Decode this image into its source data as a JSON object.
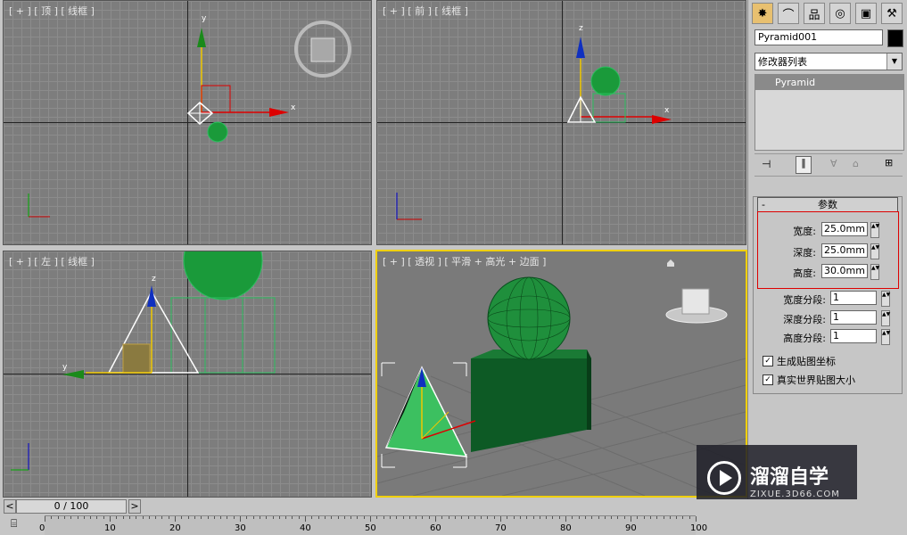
{
  "viewports": {
    "top": {
      "label": "[ + ] [ 顶 ] [ 线框 ]"
    },
    "front": {
      "label": "[ + ] [ 前 ] [ 线框 ]"
    },
    "left": {
      "label": "[ + ] [ 左 ] [ 线框 ]"
    },
    "persp": {
      "label": "[ + ] [ 透视 ] [ 平滑 + 高光 + 边面 ]"
    }
  },
  "axis_letters": {
    "x": "x",
    "y": "y",
    "z": "z"
  },
  "panel": {
    "object_name": "Pyramid001",
    "modifier_list": "修改器列表",
    "stack_item": "Pyramid",
    "rollout_title": "参数",
    "params": [
      {
        "label": "宽度:",
        "value": "25.0mm"
      },
      {
        "label": "深度:",
        "value": "25.0mm"
      },
      {
        "label": "高度:",
        "value": "30.0mm"
      }
    ],
    "segments": [
      {
        "label": "宽度分段:",
        "value": "1"
      },
      {
        "label": "深度分段:",
        "value": "1"
      },
      {
        "label": "高度分段:",
        "value": "1"
      }
    ],
    "checks": [
      {
        "label": "生成贴图坐标",
        "checked": true
      },
      {
        "label": "真实世界贴图大小",
        "checked": true
      }
    ]
  },
  "timeline": {
    "frame": "0 / 100",
    "prev": "<",
    "next": ">",
    "ticks": [
      "0",
      "10",
      "20",
      "30",
      "40",
      "50",
      "60",
      "70",
      "80",
      "90",
      "100"
    ]
  },
  "watermark": {
    "title": "溜溜自学",
    "url": "ZIXUE.3D66.COM"
  }
}
